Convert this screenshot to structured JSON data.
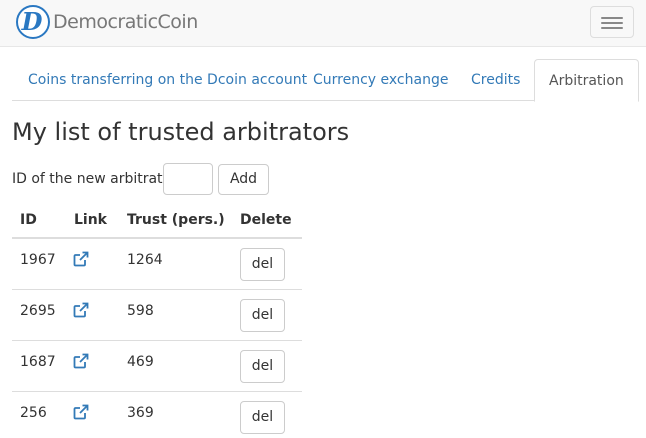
{
  "brand": {
    "letter": "D",
    "name": "DemocraticCoin"
  },
  "tabs": [
    {
      "label": "Coins transferring on the Dcoin account",
      "active": false
    },
    {
      "label": "Currency exchange",
      "active": false
    },
    {
      "label": "Credits",
      "active": false
    },
    {
      "label": "Arbitration",
      "active": true
    }
  ],
  "page_title": "My list of trusted arbitrators",
  "new_arbitrator": {
    "label": "ID of the new arbitrator",
    "value": "",
    "add_label": "Add"
  },
  "table": {
    "headers": [
      "ID",
      "Link",
      "Trust (pers.)",
      "Delete"
    ],
    "rows": [
      {
        "id": "1967",
        "trust": "1264",
        "delete_label": "del"
      },
      {
        "id": "2695",
        "trust": "598",
        "delete_label": "del"
      },
      {
        "id": "1687",
        "trust": "469",
        "delete_label": "del"
      },
      {
        "id": "256",
        "trust": "369",
        "delete_label": "del"
      }
    ]
  },
  "colors": {
    "link": "#337ab7",
    "brand": "#2a78c2",
    "navbar_bg": "#f8f8f8"
  }
}
